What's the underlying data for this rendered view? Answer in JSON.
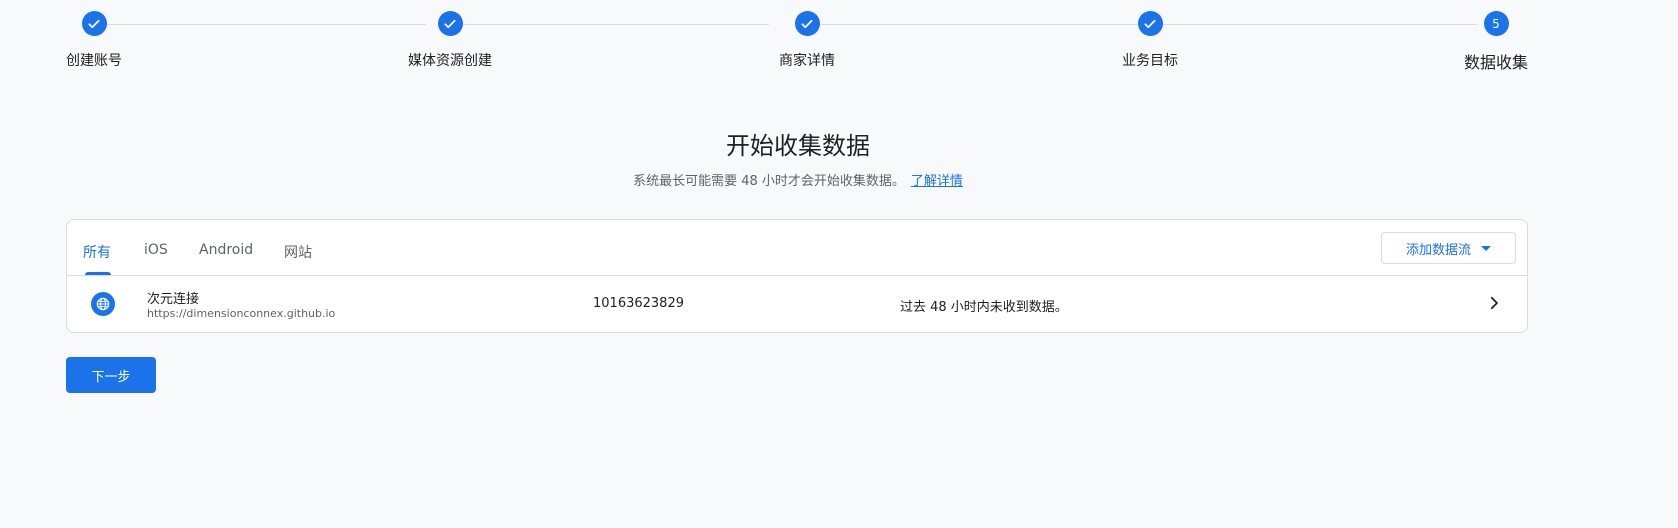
{
  "stepper": {
    "steps": [
      {
        "label": "创建账号",
        "state": "complete"
      },
      {
        "label": "媒体资源创建",
        "state": "complete"
      },
      {
        "label": "商家详情",
        "state": "complete"
      },
      {
        "label": "业务目标",
        "state": "complete"
      },
      {
        "label": "数据收集",
        "state": "current",
        "number": "5"
      }
    ]
  },
  "main": {
    "title": "开始收集数据",
    "subtitle": "系统最长可能需要 48 小时才会开始收集数据。",
    "learn_more": "了解详情"
  },
  "streams_card": {
    "tabs": [
      {
        "label": "所有",
        "active": true
      },
      {
        "label": "iOS",
        "active": false
      },
      {
        "label": "Android",
        "active": false
      },
      {
        "label": "网站",
        "active": false
      }
    ],
    "add_stream_label": "添加数据流",
    "rows": [
      {
        "icon": "globe-icon",
        "name": "次元连接",
        "url": "https://dimensionconnex.github.io",
        "stream_id": "10163623829",
        "status": "过去 48 小时内未收到数据。"
      }
    ]
  },
  "footer": {
    "next_label": "下一步"
  },
  "colors": {
    "accent": "#1a73e8",
    "background": "#f8f9fa",
    "border": "#dadce0"
  }
}
